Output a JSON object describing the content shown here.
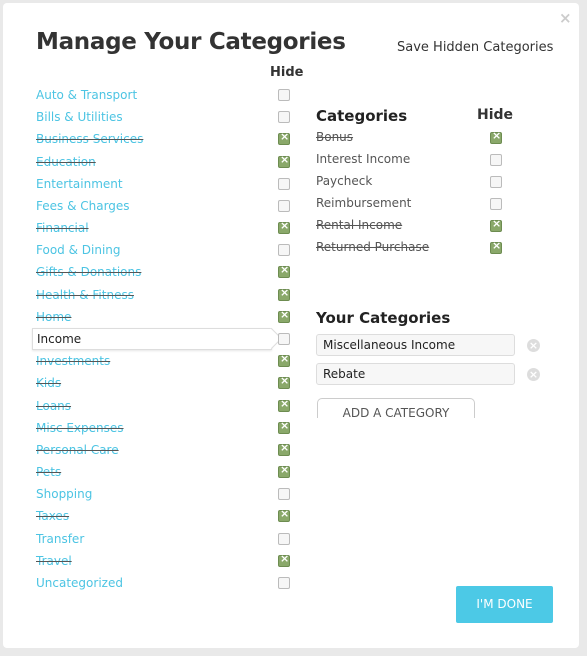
{
  "title": "Manage Your Categories",
  "save_hidden": "Save Hidden Categories",
  "close": "×",
  "hide_label": "Hide",
  "categories": [
    {
      "label": "Auto & Transport",
      "hidden": false
    },
    {
      "label": "Bills & Utilities",
      "hidden": false
    },
    {
      "label": "Business Services",
      "hidden": true
    },
    {
      "label": "Education",
      "hidden": true
    },
    {
      "label": "Entertainment",
      "hidden": false
    },
    {
      "label": "Fees & Charges",
      "hidden": false
    },
    {
      "label": "Financial",
      "hidden": true
    },
    {
      "label": "Food & Dining",
      "hidden": false
    },
    {
      "label": "Gifts & Donations",
      "hidden": true
    },
    {
      "label": "Health & Fitness",
      "hidden": true
    },
    {
      "label": "Home",
      "hidden": true
    },
    {
      "label": "Income",
      "hidden": false,
      "selected": true
    },
    {
      "label": "Investments",
      "hidden": true
    },
    {
      "label": "Kids",
      "hidden": true
    },
    {
      "label": "Loans",
      "hidden": true
    },
    {
      "label": "Misc Expenses",
      "hidden": true
    },
    {
      "label": "Personal Care",
      "hidden": true
    },
    {
      "label": "Pets",
      "hidden": true
    },
    {
      "label": "Shopping",
      "hidden": false
    },
    {
      "label": "Taxes",
      "hidden": true
    },
    {
      "label": "Transfer",
      "hidden": false
    },
    {
      "label": "Travel",
      "hidden": true
    },
    {
      "label": "Uncategorized",
      "hidden": false
    }
  ],
  "subcategories_title": "Categories",
  "subcategories": [
    {
      "label": "Bonus",
      "hidden": true
    },
    {
      "label": "Interest Income",
      "hidden": false
    },
    {
      "label": "Paycheck",
      "hidden": false
    },
    {
      "label": "Reimbursement",
      "hidden": false
    },
    {
      "label": "Rental Income",
      "hidden": true
    },
    {
      "label": "Returned Purchase",
      "hidden": true
    }
  ],
  "your_categories_title": "Your Categories",
  "your_categories": [
    "Miscellaneous Income",
    "Rebate"
  ],
  "add_category": "ADD A CATEGORY",
  "done": "I'M DONE"
}
